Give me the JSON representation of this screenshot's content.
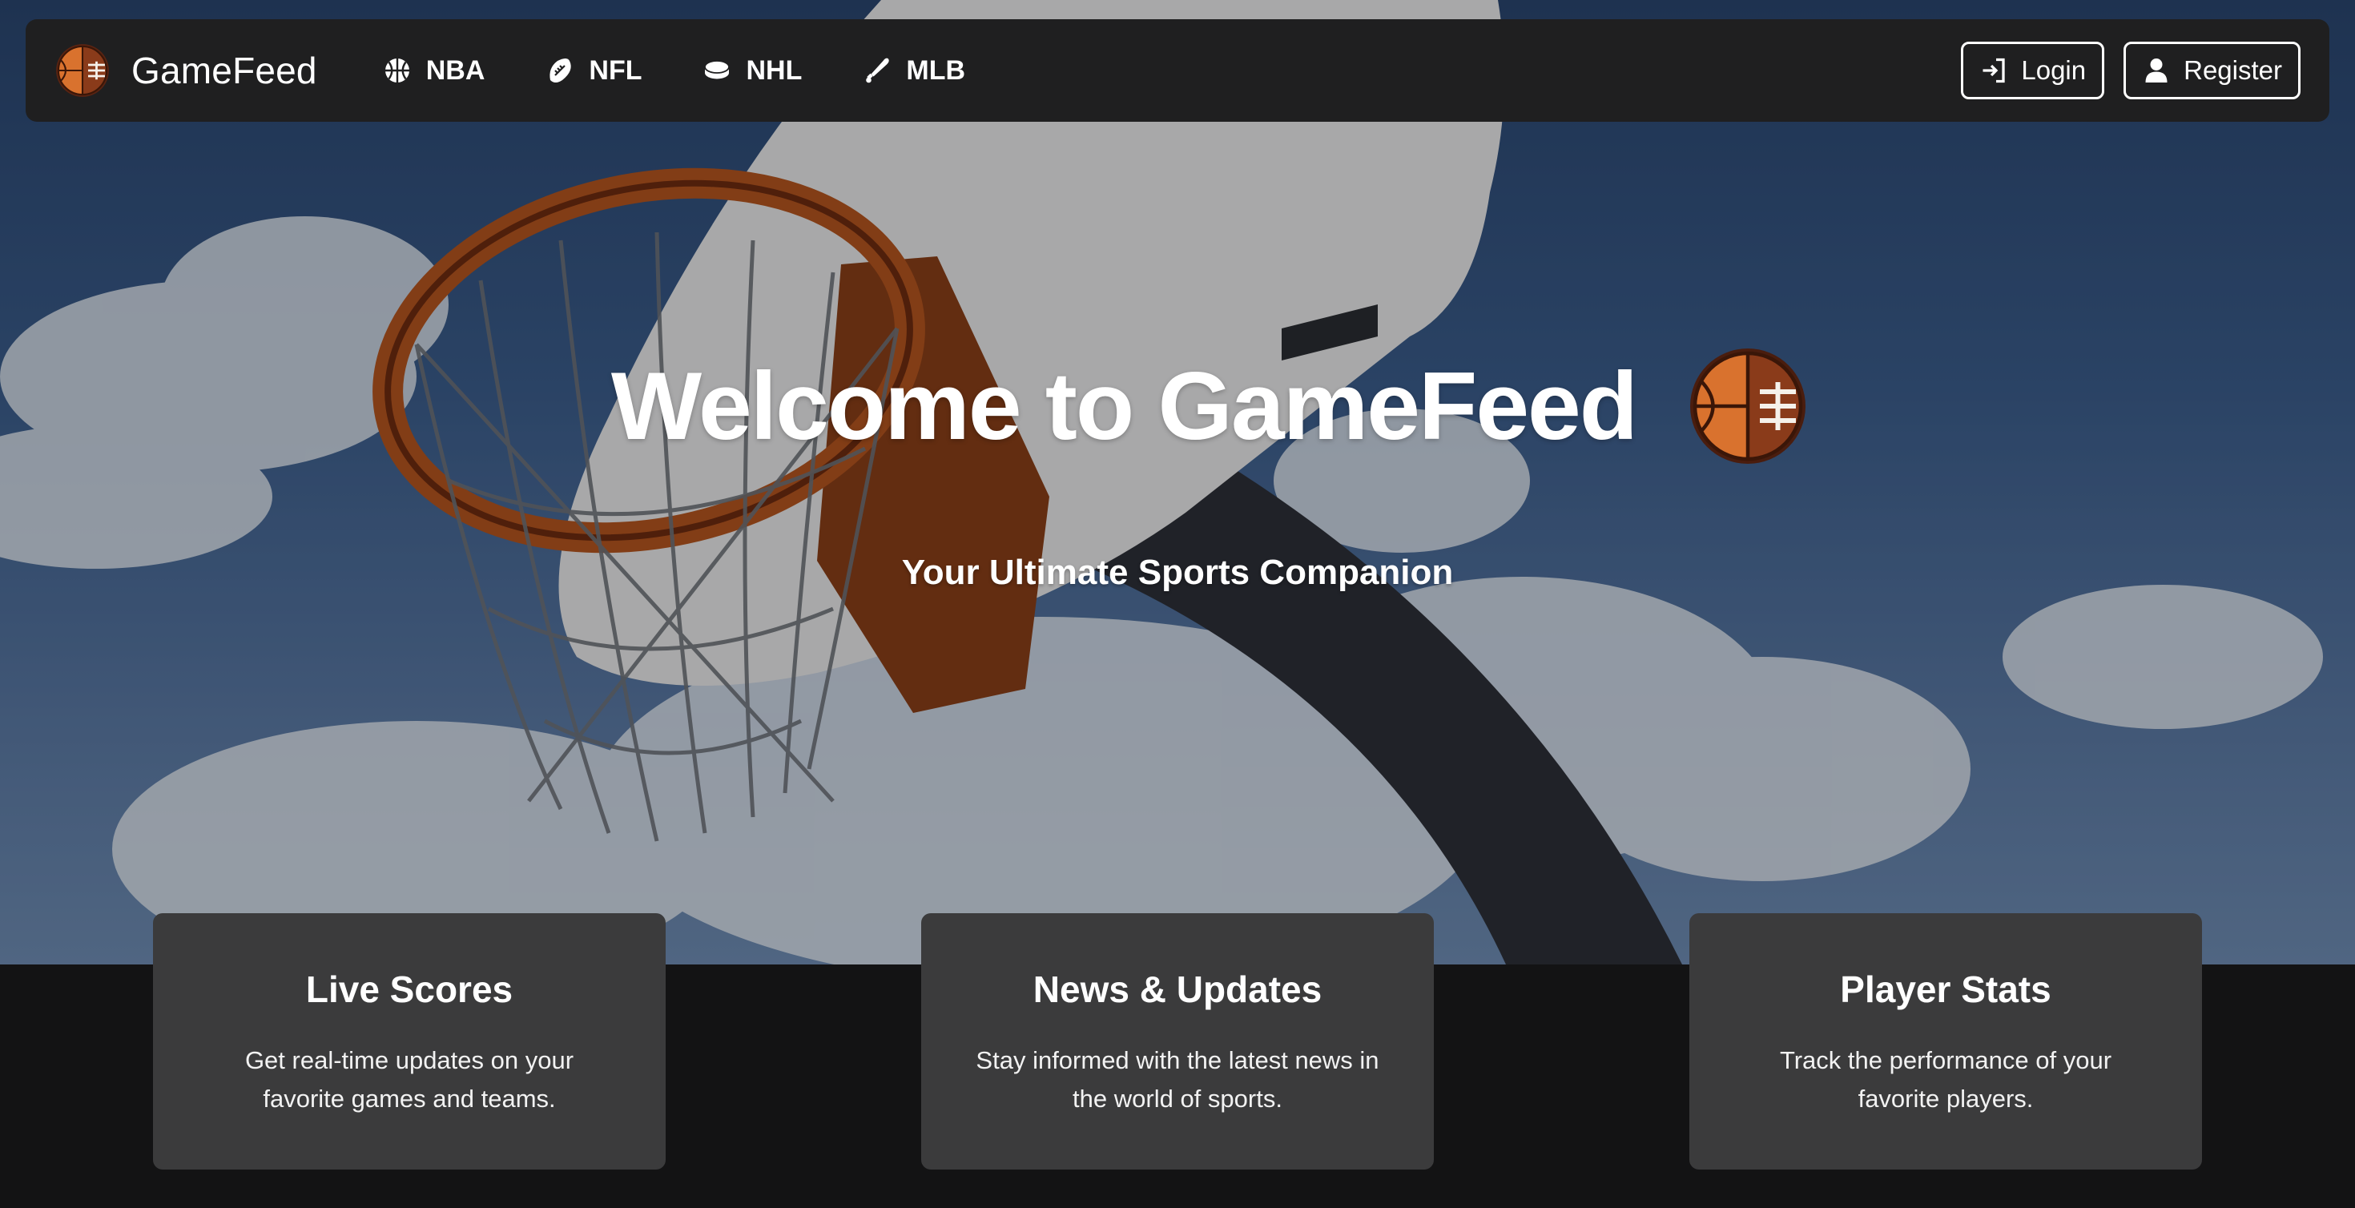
{
  "navbar": {
    "brand": "GameFeed",
    "links": [
      {
        "label": "NBA",
        "icon": "basketball-icon"
      },
      {
        "label": "NFL",
        "icon": "football-icon"
      },
      {
        "label": "NHL",
        "icon": "hockey-puck-icon"
      },
      {
        "label": "MLB",
        "icon": "baseball-bat-icon"
      }
    ],
    "login_label": "Login",
    "register_label": "Register"
  },
  "hero": {
    "title": "Welcome to GameFeed",
    "subtitle": "Your Ultimate Sports Companion"
  },
  "features": [
    {
      "title": "Live Scores",
      "text": "Get real-time updates on your favorite games and teams."
    },
    {
      "title": "News & Updates",
      "text": "Stay informed with the latest news in the world of sports."
    },
    {
      "title": "Player Stats",
      "text": "Track the performance of your favorite players."
    }
  ],
  "colors": {
    "navbar_bg": "#1f1f20",
    "card_bg": "#3b3b3c",
    "page_bg": "#131314",
    "logo_orange": "#d06a2a"
  }
}
